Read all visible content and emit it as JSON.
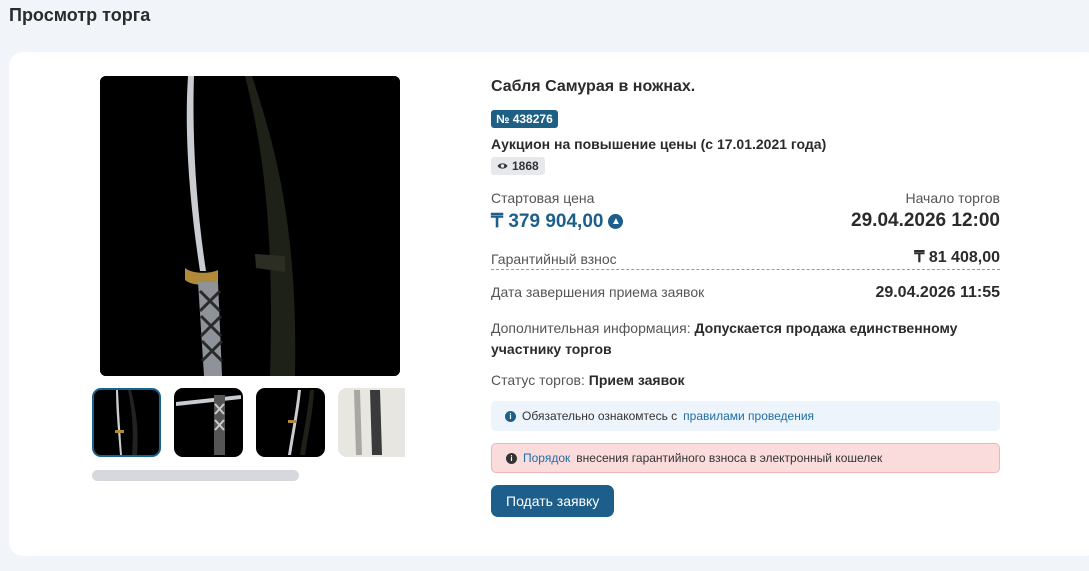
{
  "page": {
    "title": "Просмотр торга"
  },
  "lot": {
    "title": "Сабля Самурая в ножнах.",
    "number": "№ 438276",
    "auction_type": "Аукцион на повышение цены (с 17.01.2021 года)",
    "views": "1868"
  },
  "pricing": {
    "start_price_label": "Стартовая цена",
    "start_price": "₸ 379 904,00",
    "start_label": "Начало торгов",
    "start_date": "29.04.2026 12:00",
    "guarantee_label": "Гарантийный взнос",
    "guarantee_value": "₸ 81 408,00",
    "deadline_label": "Дата завершения приема заявок",
    "deadline_value": "29.04.2026 11:55"
  },
  "extra": {
    "label": "Дополнительная информация:",
    "value": "Допускается продажа единственному участнику торгов"
  },
  "status": {
    "label": "Статус торгов:",
    "value": "Прием заявок"
  },
  "notices": {
    "rules_prefix": "Обязательно ознакомтесь с",
    "rules_link": "правилами проведения",
    "order_link": "Порядок",
    "order_suffix": "внесения гарантийного взноса в электронный кошелек"
  },
  "actions": {
    "submit": "Подать заявку"
  },
  "icons": [
    "eye-icon",
    "arrow-up-icon",
    "info-icon"
  ],
  "colors": {
    "accent": "#1d5f8a",
    "warning_bg": "#fbdcdc"
  }
}
